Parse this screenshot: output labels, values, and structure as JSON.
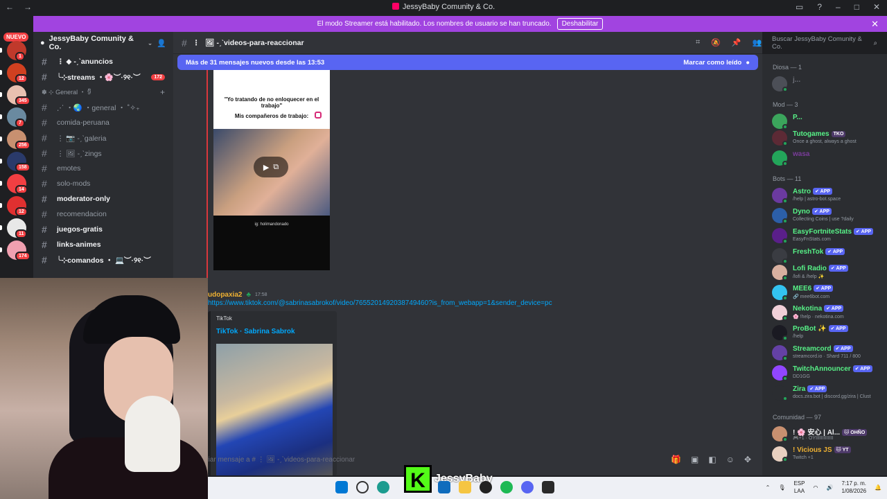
{
  "window": {
    "title": "JessyBaby Comunity & Co."
  },
  "banner": {
    "text": "El modo Streamer está habilitado. Los nombres de usuario se han truncado.",
    "button": "Deshabilitar"
  },
  "guilds": {
    "new_label": "NUEVO",
    "badges": [
      "1",
      "12",
      "345",
      "7",
      "256",
      "158",
      "14",
      "12",
      "11",
      "174"
    ]
  },
  "server": {
    "name": "JessyBaby Comunity & Co."
  },
  "channels": [
    {
      "name": "⋮ ◆ -ˏˋanuncios",
      "unread": true
    },
    {
      "name": "╰⊹streams ・🌸︶·୨୧·︶",
      "unread": true,
      "count": "172"
    },
    {
      "category": "✽ ⊹ General ・ 9ᩚ"
    },
    {
      "name": "⋰ ・🌏 ・general ・ ˚✧₊",
      "unread": false
    },
    {
      "name": "comida-peruana",
      "unread": false
    },
    {
      "name": "⋮ 📷 -ˏˋgaleria",
      "unread": false
    },
    {
      "name": "⋮ 🖼 -ˏˋzings",
      "unread": false
    },
    {
      "name": "emotes",
      "unread": false
    },
    {
      "name": "solo-mods",
      "unread": false
    },
    {
      "name": "moderator-only",
      "unread": true
    },
    {
      "name": "recomendacion",
      "unread": false
    },
    {
      "name": "juegos-gratis",
      "unread": true
    },
    {
      "name": "links-animes",
      "unread": true
    },
    {
      "name": "╰⊹comandos ・ 💻︶·୨୧·︶",
      "unread": true
    }
  ],
  "channel_header": {
    "name": "🖼 -ˏˋvideos-para-reaccionar"
  },
  "search": {
    "placeholder": "Buscar JessyBaby Comunity & Co."
  },
  "new_messages": {
    "text": "Más de 31 mensajes nuevos desde las 13:53",
    "mark": "Marcar como leído"
  },
  "embed1": {
    "line1": "\"Yo tratando de no enloquecer en el trabajo\"",
    "line2": "Mis compañeros de trabajo:",
    "caption": "ig: holimandonado"
  },
  "message2": {
    "author": "udopaxia2",
    "time": "17:58",
    "link": "https://www.tiktok.com/@sabrinasabrokof/video/7655201492038749460?is_from_webapp=1&sender_device=pc",
    "provider": "TikTok",
    "title": "TikTok · Sabrina Sabrok"
  },
  "composer": {
    "placeholder": "nviar mensaje a # ⋮ 🖼 -ˏˋvideos-para-reaccionar"
  },
  "members": {
    "sections": [
      {
        "title": "Diosa — 1",
        "items": [
          {
            "name": "j...",
            "sub": "",
            "color": "#4c4f57",
            "nameColor": "#6d6f78"
          }
        ]
      },
      {
        "title": "Mod — 3",
        "items": [
          {
            "name": "P...",
            "sub": "",
            "color": "#3ba55c",
            "nameColor": "#57f287"
          },
          {
            "name": "Tutogames",
            "tag": "TKO",
            "sub": "Once a ghost, always a ghost",
            "color": "#5c2a35",
            "nameColor": "#57f287"
          },
          {
            "name": "wasa",
            "sub": "",
            "color": "#23a55a",
            "nameColor": "#7a3c9a"
          }
        ]
      },
      {
        "title": "Bots — 11",
        "items": [
          {
            "name": "Astro",
            "tag": "✔ APP",
            "sub": "/help | astro-bot.space",
            "color": "#6b3aa0",
            "nameColor": "#57f287"
          },
          {
            "name": "Dyno",
            "tag": "✔ APP",
            "sub": "Collecting Coins | use ?daily",
            "color": "#2c5fa8",
            "nameColor": "#57f287"
          },
          {
            "name": "EasyFortniteStats",
            "tag": "✔ APP",
            "sub": "EasyFnStats.com",
            "color": "#5a1f8a",
            "nameColor": "#57f287"
          },
          {
            "name": "FreshTok",
            "tag": "✔ APP",
            "sub": "",
            "color": "#3a3c42",
            "nameColor": "#57f287"
          },
          {
            "name": "Lofi Radio",
            "tag": "✔ APP",
            "sub": "/lofi & /help ✨",
            "color": "#d8b0a0",
            "nameColor": "#57f287"
          },
          {
            "name": "MEE6",
            "tag": "✔ APP",
            "sub": "🔗 mee6bot.com",
            "color": "#33c3f0",
            "nameColor": "#57f287"
          },
          {
            "name": "Nekotina",
            "tag": "✔ APP",
            "sub": "🌸 !help · nekotina.com",
            "color": "#f0d0d8",
            "nameColor": "#57f287"
          },
          {
            "name": "ProBot ✨",
            "tag": "✔ APP",
            "sub": "/help",
            "color": "#1a1a22",
            "nameColor": "#57f287"
          },
          {
            "name": "Streamcord",
            "tag": "✔ APP",
            "sub": "streamcord.io · Shard 711 / 800",
            "color": "#6441a5",
            "nameColor": "#57f287"
          },
          {
            "name": "TwitchAnnouncer",
            "tag": "✔ APP",
            "sub": "DD1GG",
            "color": "#9146ff",
            "nameColor": "#57f287"
          },
          {
            "name": "Zira",
            "tag": "✔ APP",
            "sub": "docs.zira.bot | discord.gg/zira | Clust",
            "color": "#2b2d31",
            "nameColor": "#57f287"
          }
        ]
      },
      {
        "title": "Comunidad — 97",
        "items": [
          {
            "name": "! 🌸 安心 | Al...",
            "tag": "🐱 OHÑO",
            "sub": "🎮+1 · OYIIIIIIIIIIIII",
            "color": "#c89070",
            "nameColor": "#f2f3f5"
          },
          {
            "name": "! Vicious JS",
            "tag": "🐱 YT",
            "sub": "Twitch +1",
            "color": "#e8d0c0",
            "nameColor": "#f0b232"
          }
        ]
      }
    ]
  },
  "taskbar": {
    "streamer": "JessyBaby",
    "lang1": "ESP",
    "lang2": "LAA",
    "time": "7:17 p. m.",
    "date": "1/08/2026"
  }
}
